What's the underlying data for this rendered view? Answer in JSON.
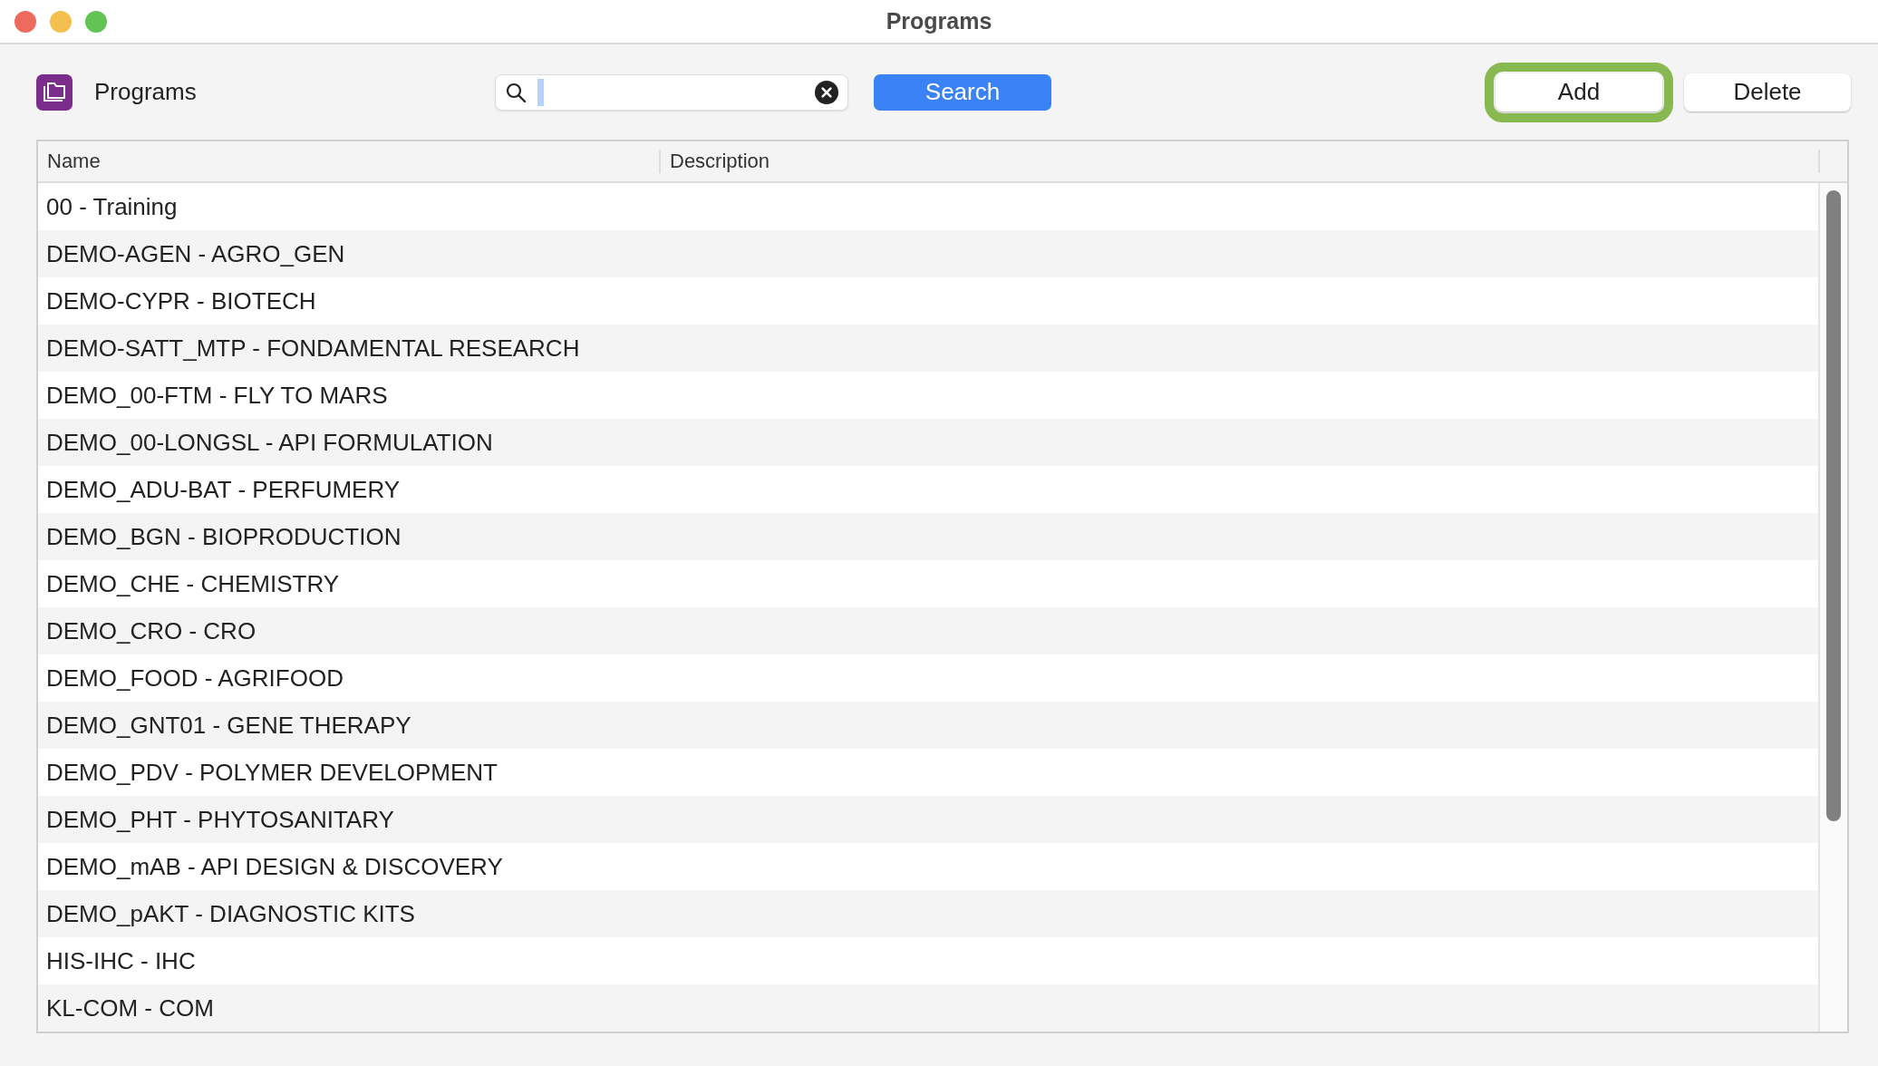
{
  "window": {
    "title": "Programs"
  },
  "toolbar": {
    "title": "Programs",
    "search_button": "Search",
    "actions": [
      {
        "label": "Add",
        "highlighted": true
      },
      {
        "label": "Delete",
        "highlighted": false
      }
    ]
  },
  "table": {
    "columns": [
      "Name",
      "Description"
    ],
    "rows": [
      {
        "name": "00 - Training"
      },
      {
        "name": "DEMO-AGEN - AGRO_GEN"
      },
      {
        "name": "DEMO-CYPR - BIOTECH"
      },
      {
        "name": "DEMO-SATT_MTP - FONDAMENTAL RESEARCH"
      },
      {
        "name": "DEMO_00-FTM - FLY TO MARS"
      },
      {
        "name": "DEMO_00-LONGSL - API FORMULATION"
      },
      {
        "name": "DEMO_ADU-BAT - PERFUMERY"
      },
      {
        "name": "DEMO_BGN - BIOPRODUCTION"
      },
      {
        "name": "DEMO_CHE - CHEMISTRY"
      },
      {
        "name": "DEMO_CRO - CRO"
      },
      {
        "name": "DEMO_FOOD - AGRIFOOD"
      },
      {
        "name": "DEMO_GNT01 - GENE THERAPY"
      },
      {
        "name": "DEMO_PDV - POLYMER DEVELOPMENT"
      },
      {
        "name": "DEMO_PHT - PHYTOSANITARY"
      },
      {
        "name": "DEMO_mAB - API DESIGN & DISCOVERY"
      },
      {
        "name": "DEMO_pAKT - DIAGNOSTIC KITS"
      },
      {
        "name": "HIS-IHC - IHC"
      },
      {
        "name": "KL-COM - COM"
      }
    ]
  }
}
